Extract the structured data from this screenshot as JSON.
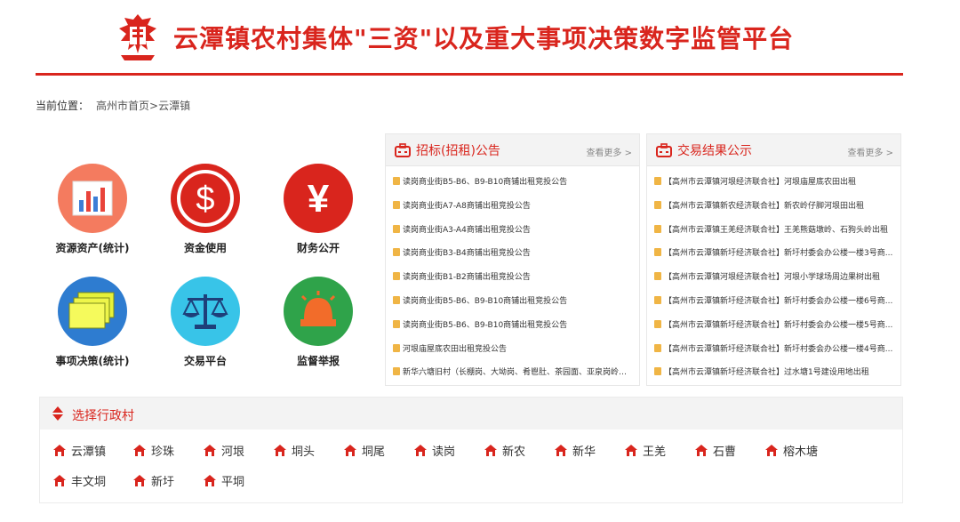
{
  "header": {
    "title": "云潭镇农村集体\"三资\"以及重大事项决策数字监管平台",
    "accent": "#d9251d"
  },
  "breadcrumb": {
    "label": "当前位置：",
    "path": "高州市首页>云潭镇"
  },
  "modules": [
    {
      "label": "资源资产(统计)",
      "icon": "bar-chart-icon",
      "color": "#f47b5f"
    },
    {
      "label": "资金使用",
      "icon": "dollar-icon",
      "color": "#d9251d"
    },
    {
      "label": "财务公开",
      "icon": "yen-icon",
      "color": "#d9251d"
    },
    {
      "label": "事项决策(统计)",
      "icon": "stack-icon",
      "color": "#2e7cd0"
    },
    {
      "label": "交易平台",
      "icon": "scales-icon",
      "color": "#38c4e8"
    },
    {
      "label": "监督举报",
      "icon": "alarm-icon",
      "color": "#2fa34a"
    }
  ],
  "tender_panel": {
    "title": "招标(招租)公告",
    "more": "查看更多 >",
    "items": [
      "读岗商业街B5-B6、B9-B10商铺出租竞投公告",
      "读岗商业街A7-A8商铺出租竞投公告",
      "读岗商业街A3-A4商铺出租竞投公告",
      "读岗商业街B3-B4商铺出租竞投公告",
      "读岗商业街B1-B2商铺出租竞投公告",
      "读岗商业街B5-B6、B9-B10商铺出租竞投公告",
      "读岗商业街B5-B6、B9-B10商铺出租竞投公告",
      "河垠庙屋底农田出租竞投公告",
      "新华六塘旧村（长棚岗、大坳岗、肴鬯肚、茶园面、亚泉岗岭）..."
    ]
  },
  "result_panel": {
    "title": "交易结果公示",
    "more": "查看更多 >",
    "items": [
      "【高州市云潭镇河垠经济联合社】河垠庙屋底农田出租",
      "【高州市云潭镇新农经济联合社】新农岭仔脚河垠田出租",
      "【高州市云潭镇王羌经济联合社】王羌熊菇墩岭、石狗头岭出租",
      "【高州市云潭镇新圩经济联合社】新圩村委会办公楼一楼3号商...",
      "【高州市云潭镇河垠经济联合社】河垠小学球场周边果树出租",
      "【高州市云潭镇新圩经济联合社】新圩村委会办公楼一楼6号商...",
      "【高州市云潭镇新圩经济联合社】新圩村委会办公楼一楼5号商...",
      "【高州市云潭镇新圩经济联合社】新圩村委会办公楼一楼4号商...",
      "【高州市云潭镇新圩经济联合社】过水塘1号建设用地出租"
    ]
  },
  "villages": {
    "title": "选择行政村",
    "items": [
      "云潭镇",
      "珍珠",
      "河垠",
      "垌头",
      "垌尾",
      "读岗",
      "新农",
      "新华",
      "王羌",
      "石曹",
      "榕木塘",
      "丰文垌",
      "新圩",
      "平垌"
    ]
  }
}
